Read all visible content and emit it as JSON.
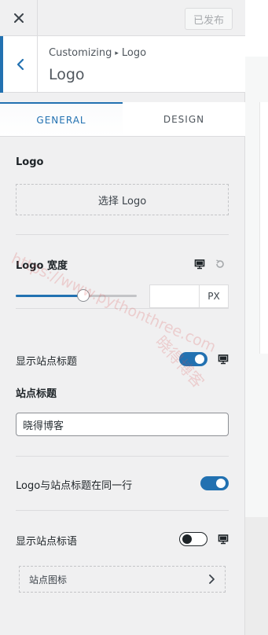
{
  "header": {
    "publish_label": "已发布"
  },
  "section": {
    "breadcrumb_root": "Customizing",
    "breadcrumb_sep": "▸",
    "breadcrumb_leaf": "Logo",
    "title": "Logo"
  },
  "tabs": [
    {
      "label": "GENERAL",
      "active": true
    },
    {
      "label": "DESIGN",
      "active": false
    }
  ],
  "logo": {
    "label": "Logo",
    "select_button": "选择 Logo"
  },
  "logo_width": {
    "label": "Logo 宽度",
    "value": "",
    "unit": "PX",
    "slider_fraction": 0.56
  },
  "show_site_title": {
    "label": "显示站点标题",
    "enabled": true
  },
  "site_title": {
    "label": "站点标题",
    "value": "晓得博客"
  },
  "logo_same_line": {
    "label": "Logo与站点标题在同一行",
    "enabled": true
  },
  "show_tagline": {
    "label": "显示站点标语",
    "enabled": false
  },
  "site_icon": {
    "label": "站点图标"
  },
  "watermark": {
    "url": "https://www.pythonthree.com",
    "name": "晓得博客"
  },
  "colors": {
    "accent": "#2271b1",
    "panel_bg": "#f0f0f1",
    "border": "#dcdcde"
  }
}
